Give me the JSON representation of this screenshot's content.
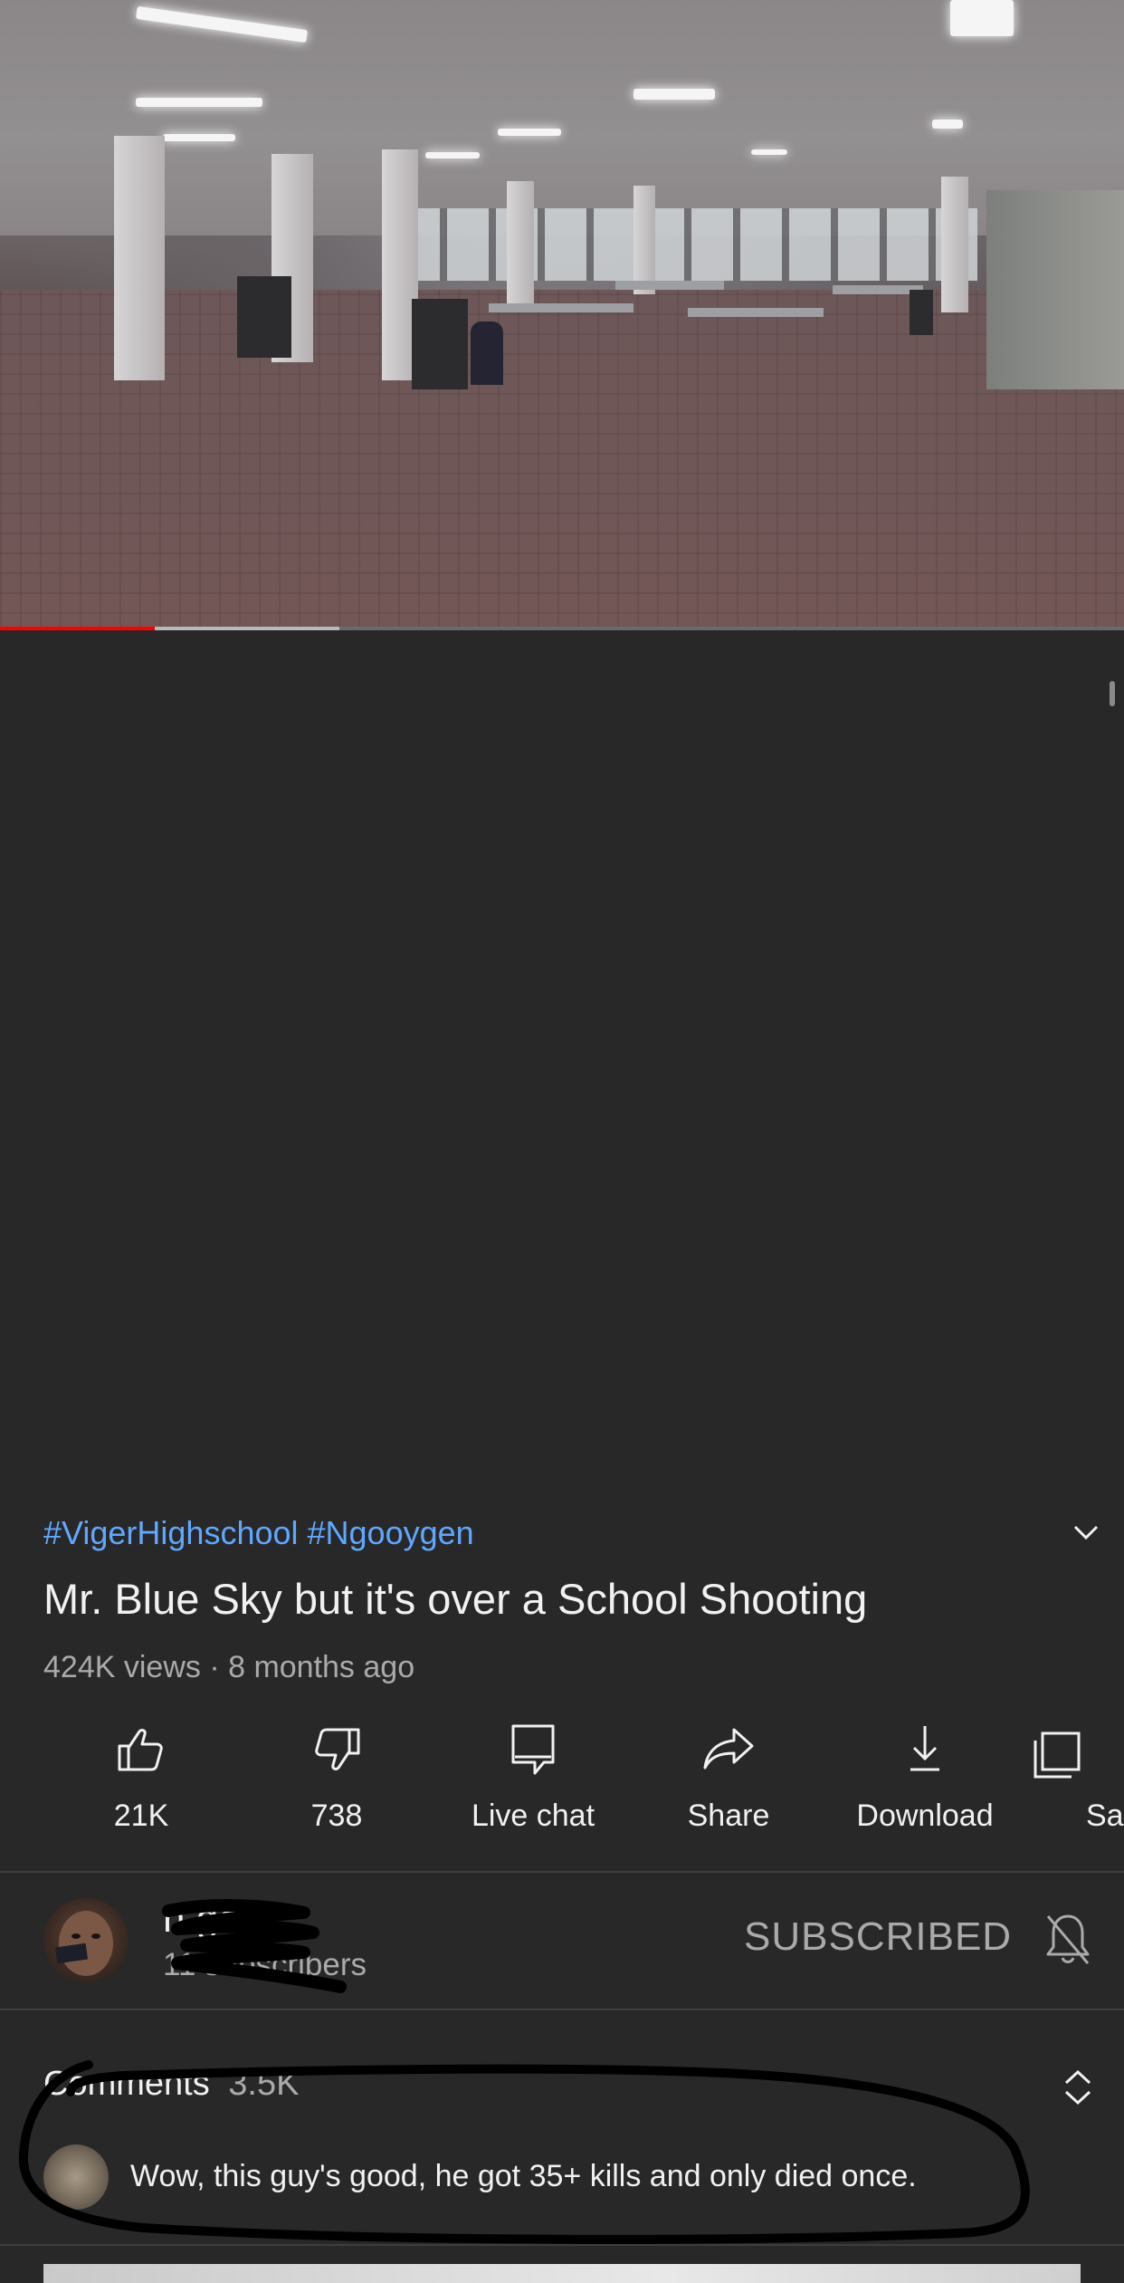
{
  "video": {
    "progress_played": 0.138,
    "progress_buffered": 0.302
  },
  "info": {
    "hashtags": "#VigerHighschool #Ngooygen",
    "title": "Mr. Blue Sky but it's over a School Shooting",
    "meta": "424K views · 8 months ago"
  },
  "actions": [
    {
      "label": "21K",
      "icon": "thumbs-up-icon"
    },
    {
      "label": "738",
      "icon": "thumbs-down-icon"
    },
    {
      "label": "Live chat",
      "icon": "live-chat-icon"
    },
    {
      "label": "Share",
      "icon": "share-icon"
    },
    {
      "label": "Download",
      "icon": "download-icon"
    },
    {
      "label": "Sa",
      "icon": "save-icon"
    }
  ],
  "channel": {
    "name": "n    gen",
    "subscribers": "11    subscribers",
    "subscribe_label": "SUBSCRIBED",
    "bell_icon": "bell-off-icon"
  },
  "comments": {
    "label": "Comments",
    "count": "3.5K",
    "top_comment": "Wow, this guy's good, he got 35+ kills and only died once."
  },
  "colors": {
    "background": "#282828",
    "hashtag": "#5ea8ff",
    "progress": "#ff0000",
    "secondary_text": "#aaaaaa"
  }
}
